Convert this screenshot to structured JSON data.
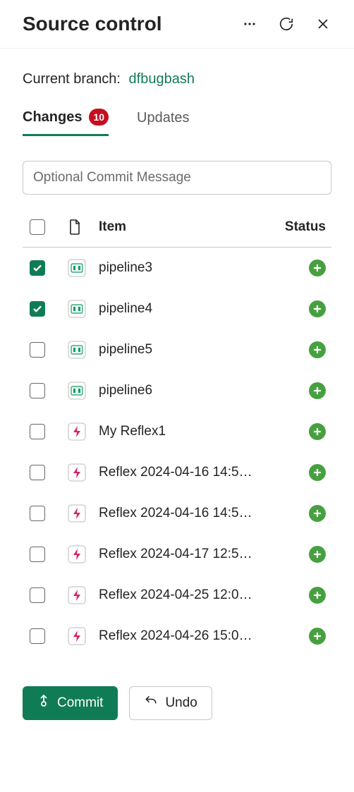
{
  "header": {
    "title": "Source control"
  },
  "branch": {
    "label": "Current branch:",
    "value": "dfbugbash"
  },
  "tabs": {
    "changes": {
      "label": "Changes",
      "count": "10"
    },
    "updates": {
      "label": "Updates"
    }
  },
  "commit_input": {
    "placeholder": "Optional Commit Message"
  },
  "table": {
    "headers": {
      "item": "Item",
      "status": "Status"
    },
    "rows": [
      {
        "name": "pipeline3",
        "type": "pipeline",
        "checked": true,
        "status": "added"
      },
      {
        "name": "pipeline4",
        "type": "pipeline",
        "checked": true,
        "status": "added"
      },
      {
        "name": "pipeline5",
        "type": "pipeline",
        "checked": false,
        "status": "added"
      },
      {
        "name": "pipeline6",
        "type": "pipeline",
        "checked": false,
        "status": "added"
      },
      {
        "name": "My Reflex1",
        "type": "reflex",
        "checked": false,
        "status": "added"
      },
      {
        "name": "Reflex 2024-04-16 14:5…",
        "type": "reflex",
        "checked": false,
        "status": "added"
      },
      {
        "name": "Reflex 2024-04-16 14:5…",
        "type": "reflex",
        "checked": false,
        "status": "added"
      },
      {
        "name": "Reflex 2024-04-17 12:5…",
        "type": "reflex",
        "checked": false,
        "status": "added"
      },
      {
        "name": "Reflex 2024-04-25 12:0…",
        "type": "reflex",
        "checked": false,
        "status": "added"
      },
      {
        "name": "Reflex 2024-04-26 15:0…",
        "type": "reflex",
        "checked": false,
        "status": "added"
      }
    ]
  },
  "actions": {
    "commit": "Commit",
    "undo": "Undo"
  }
}
